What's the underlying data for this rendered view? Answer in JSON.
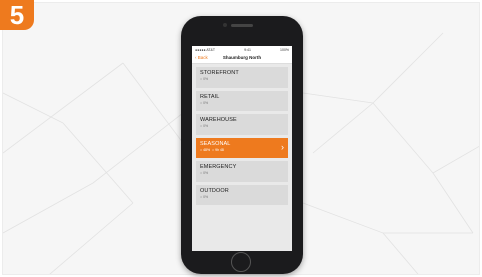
{
  "step_number": "5",
  "phone": {
    "status": {
      "left": "●●●●● AT&T",
      "time": "9:41",
      "right": "100%"
    },
    "nav": {
      "back_label": "‹ Back",
      "title": "Shaumburg North"
    },
    "list": [
      {
        "name": "STOREFRONT",
        "sub": "○ 0% "
      },
      {
        "name": "RETAIL",
        "sub": "○ 0% "
      },
      {
        "name": "WAREHOUSE",
        "sub": "○ 0% "
      },
      {
        "name": "SEASONAL",
        "sub": "○ 48%  ○ 9h 48",
        "active": true
      },
      {
        "name": "EMERGENCY",
        "sub": "○ 0% "
      },
      {
        "name": "OUTDOOR",
        "sub": "○ 0% "
      }
    ]
  },
  "colors": {
    "accent": "#ee7a1e",
    "row": "#dadada"
  }
}
